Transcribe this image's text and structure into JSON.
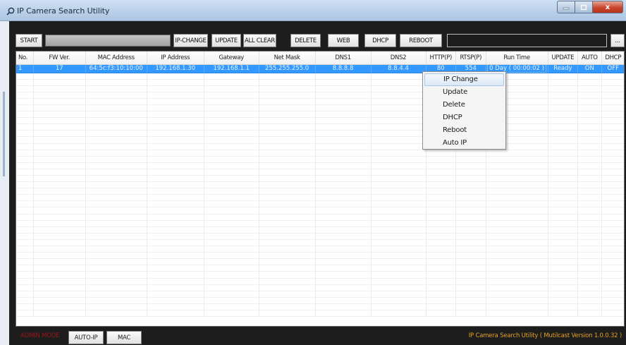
{
  "window": {
    "title": "IP Camera Search Utility",
    "buttons": {
      "minimize": "–",
      "maximize": "□",
      "close": "x"
    }
  },
  "toolbar": {
    "start": "START",
    "ip_change": "IP-CHANGE",
    "update": "UPDATE",
    "all_clear": "ALL CLEAR",
    "delete": "DELETE",
    "web": "WEB",
    "dhcp": "DHCP",
    "reboot": "REBOOT",
    "more": "...",
    "progress": 1.0
  },
  "table": {
    "columns": [
      "No.",
      "FW Ver.",
      "MAC Address",
      "IP Address",
      "Gateway",
      "Net Mask",
      "DNS1",
      "DNS2",
      "HTTP(P)",
      "RTSP(P)",
      "Run Time",
      "UPDATE",
      "AUTO",
      "DHCP"
    ],
    "rows": [
      {
        "no": "1",
        "fw": "17",
        "mac": "64:5c:f3:10:10:00",
        "ip": "192.168.1.30",
        "gateway": "192.168.1.1",
        "netmask": "255.255.255.0",
        "dns1": "8.8.8.8",
        "dns2": "8.8.4.4",
        "http": "80",
        "rtsp": "554",
        "runtime": "0 Day ( 00:00:02 )",
        "update": "Ready",
        "auto": "ON",
        "dhcp": "OFF"
      }
    ]
  },
  "context_menu": {
    "items": [
      "IP Change",
      "Update",
      "Delete",
      "DHCP",
      "Reboot",
      "Auto IP"
    ]
  },
  "footer": {
    "mode": "ADMIN MODE",
    "auto_ip": "AUTO-IP",
    "mac": "MAC",
    "version": "IP Camera Search Utility ( Mutilcast Version 1.0.0.32 )"
  },
  "colors": {
    "selection": "#3399ff",
    "frame": "#1d1d1d",
    "mode_text": "#9c1616",
    "version_text": "#e6a11e"
  }
}
